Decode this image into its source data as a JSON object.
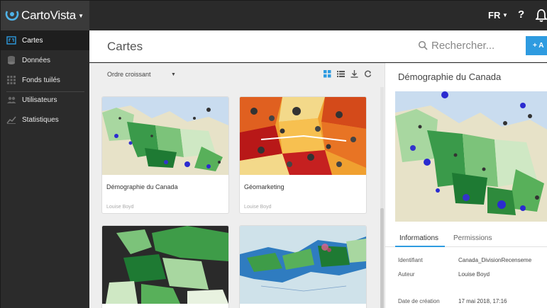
{
  "app": {
    "name": "CartoVista",
    "language": "FR",
    "help": "?"
  },
  "colors": {
    "accent": "#2e9be0",
    "topbar": "#2a2a2a",
    "sidebar": "#2b2b2b"
  },
  "sidebar": {
    "items": [
      {
        "label": "Cartes",
        "icon": "map-icon",
        "active": true
      },
      {
        "label": "Données",
        "icon": "database-icon"
      },
      {
        "label": "Fonds tuilés",
        "icon": "tiles-icon"
      },
      {
        "label": "Utilisateurs",
        "icon": "users-icon"
      },
      {
        "label": "Statistiques",
        "icon": "stats-icon"
      }
    ]
  },
  "header": {
    "title": "Cartes",
    "search_placeholder": "Rechercher...",
    "add_label": "+ A"
  },
  "list": {
    "sort_label": "Ordre croissant",
    "cards": [
      {
        "title": "Démographie du Canada",
        "author": "Louise Boyd"
      },
      {
        "title": "Géomarketing",
        "author": "Louise Boyd"
      },
      {
        "title": "",
        "author": ""
      },
      {
        "title": "",
        "author": ""
      }
    ]
  },
  "detail": {
    "title": "Démographie du Canada",
    "tabs": [
      "Informations",
      "Permissions"
    ],
    "fields": [
      {
        "label": "Identifiant",
        "value": "Canada_DivisionRecenseme"
      },
      {
        "label": "Auteur",
        "value": "Louise Boyd"
      },
      {
        "label": "Date de création",
        "value": "17 mai 2018, 17:16"
      }
    ]
  }
}
